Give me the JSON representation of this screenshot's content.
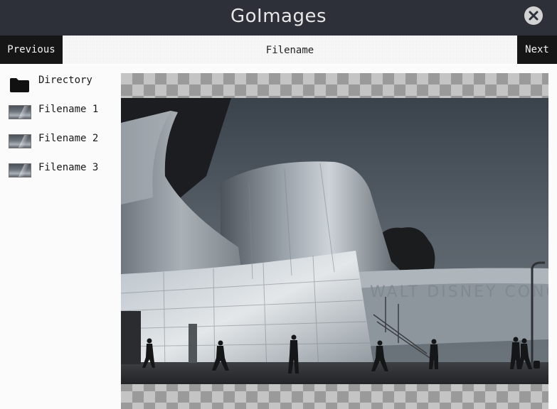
{
  "window": {
    "title": "GoImages",
    "close_icon": "close-icon"
  },
  "toolbar": {
    "previous_label": "Previous",
    "filename": "Filename",
    "next_label": "Next"
  },
  "sidebar": {
    "items": [
      {
        "label": "Directory",
        "icon": "folder-icon"
      },
      {
        "label": "Filename 1",
        "icon": "image-thumbnail"
      },
      {
        "label": "Filename 2",
        "icon": "image-thumbnail"
      },
      {
        "label": "Filename 3",
        "icon": "image-thumbnail"
      }
    ]
  },
  "viewer": {
    "background": "checkerboard-transparency",
    "image": "concert-hall-photo"
  },
  "colors": {
    "titlebar": "#2d3038",
    "nav_button": "#161616",
    "close_button": "#d2d2d2"
  }
}
